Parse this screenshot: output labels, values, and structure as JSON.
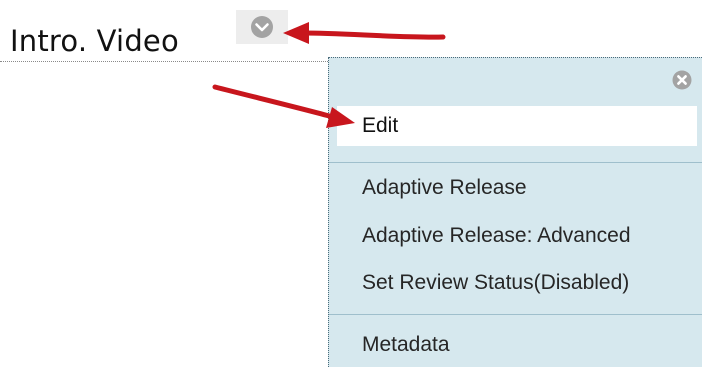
{
  "content_item": {
    "title": "Intro. Video",
    "options_icon": "chevron-down-circle-icon"
  },
  "context_menu": {
    "close_icon": "close-circle-icon",
    "items": [
      {
        "label": "Edit",
        "highlighted": true
      },
      {
        "label": "Adaptive Release"
      },
      {
        "label": "Adaptive Release: Advanced"
      },
      {
        "label": "Set Review Status(Disabled)"
      },
      {
        "label": "Metadata"
      }
    ]
  },
  "annotations": {
    "arrow_color": "#c8161d",
    "arrows": [
      "arrow-to-options-button",
      "arrow-to-edit-item"
    ]
  },
  "colors": {
    "menu_background": "#d6e8ee",
    "button_background": "#ededed",
    "icon_gray": "#a3a3a3"
  }
}
